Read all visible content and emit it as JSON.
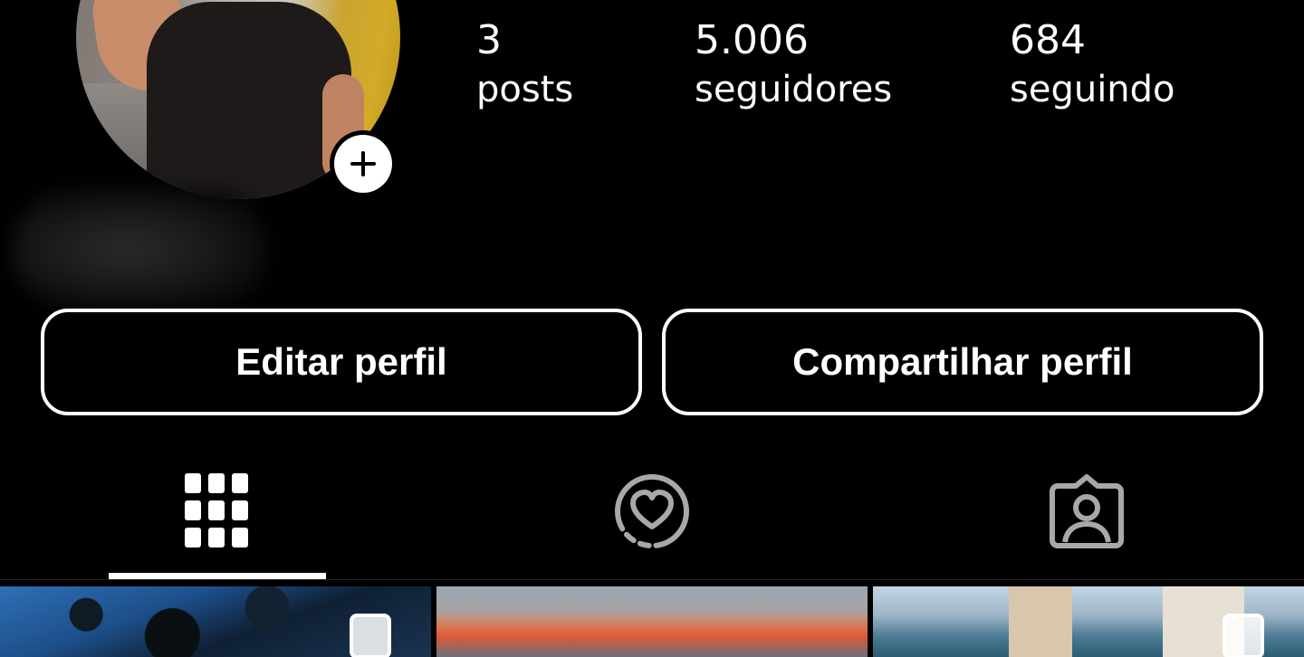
{
  "profile": {
    "stats": [
      {
        "value": "3",
        "label": "posts"
      },
      {
        "value": "5.006",
        "label": "seguidores"
      },
      {
        "value": "684",
        "label": "seguindo"
      }
    ]
  },
  "actions": {
    "edit_label": "Editar perfil",
    "share_label": "Compartilhar perfil"
  },
  "tabs": [
    {
      "icon": "grid-icon",
      "active": true
    },
    {
      "icon": "reels-heart-icon",
      "active": false
    },
    {
      "icon": "tagged-icon",
      "active": false
    }
  ],
  "grid": [
    {
      "multiple": true
    },
    {
      "multiple": false
    },
    {
      "multiple": true
    }
  ]
}
